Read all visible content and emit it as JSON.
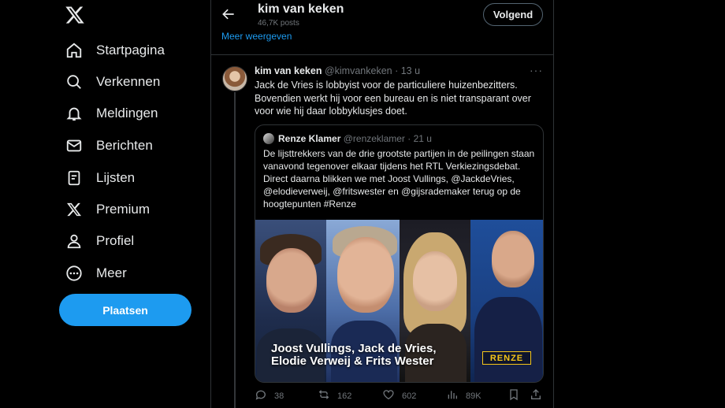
{
  "nav": {
    "items": [
      {
        "label": "Startpagina",
        "icon": "home-icon"
      },
      {
        "label": "Verkennen",
        "icon": "search-icon"
      },
      {
        "label": "Meldingen",
        "icon": "bell-icon"
      },
      {
        "label": "Berichten",
        "icon": "envelope-icon"
      },
      {
        "label": "Lijsten",
        "icon": "list-icon"
      },
      {
        "label": "Premium",
        "icon": "x-logo-icon"
      },
      {
        "label": "Profiel",
        "icon": "person-icon"
      },
      {
        "label": "Meer",
        "icon": "more-circle-icon"
      }
    ],
    "post_label": "Plaatsen"
  },
  "header": {
    "title": "kim van keken",
    "subtitle": "46,7K posts",
    "follow_label": "Volgend",
    "show_more": "Meer weergeven"
  },
  "tweet": {
    "name": "kim van keken",
    "handle_time": "@kimvankeken · 13 u",
    "text": "Jack de Vries is lobbyist voor de particuliere huizenbezitters. Bovendien werkt hij voor een bureau en is niet transparant over voor wie hij daar lobbyklusjes doet.",
    "quote": {
      "name": "Renze Klamer",
      "handle_time": "@renzeklamer · 21 u",
      "text": "De lijsttrekkers van de drie grootste partijen in de peilingen staan vanavond tegenover elkaar tijdens het RTL Verkiezingsdebat. Direct daarna blikken we met Joost Vullings, @JackdeVries, @elodieverweij, @fritswester en @gijsrademaker terug op de hoogtepunten #Renze",
      "caption_line1": "Joost Vullings, Jack de Vries,",
      "caption_line2": "Elodie Verweij & Frits Wester",
      "brand": "RENZE"
    },
    "actions": {
      "replies": "38",
      "reposts": "162",
      "likes": "602",
      "views": "89K"
    }
  },
  "colors": {
    "accent": "#1d9bf0",
    "background": "#000000",
    "border": "#2f3336",
    "muted": "#71767b"
  }
}
